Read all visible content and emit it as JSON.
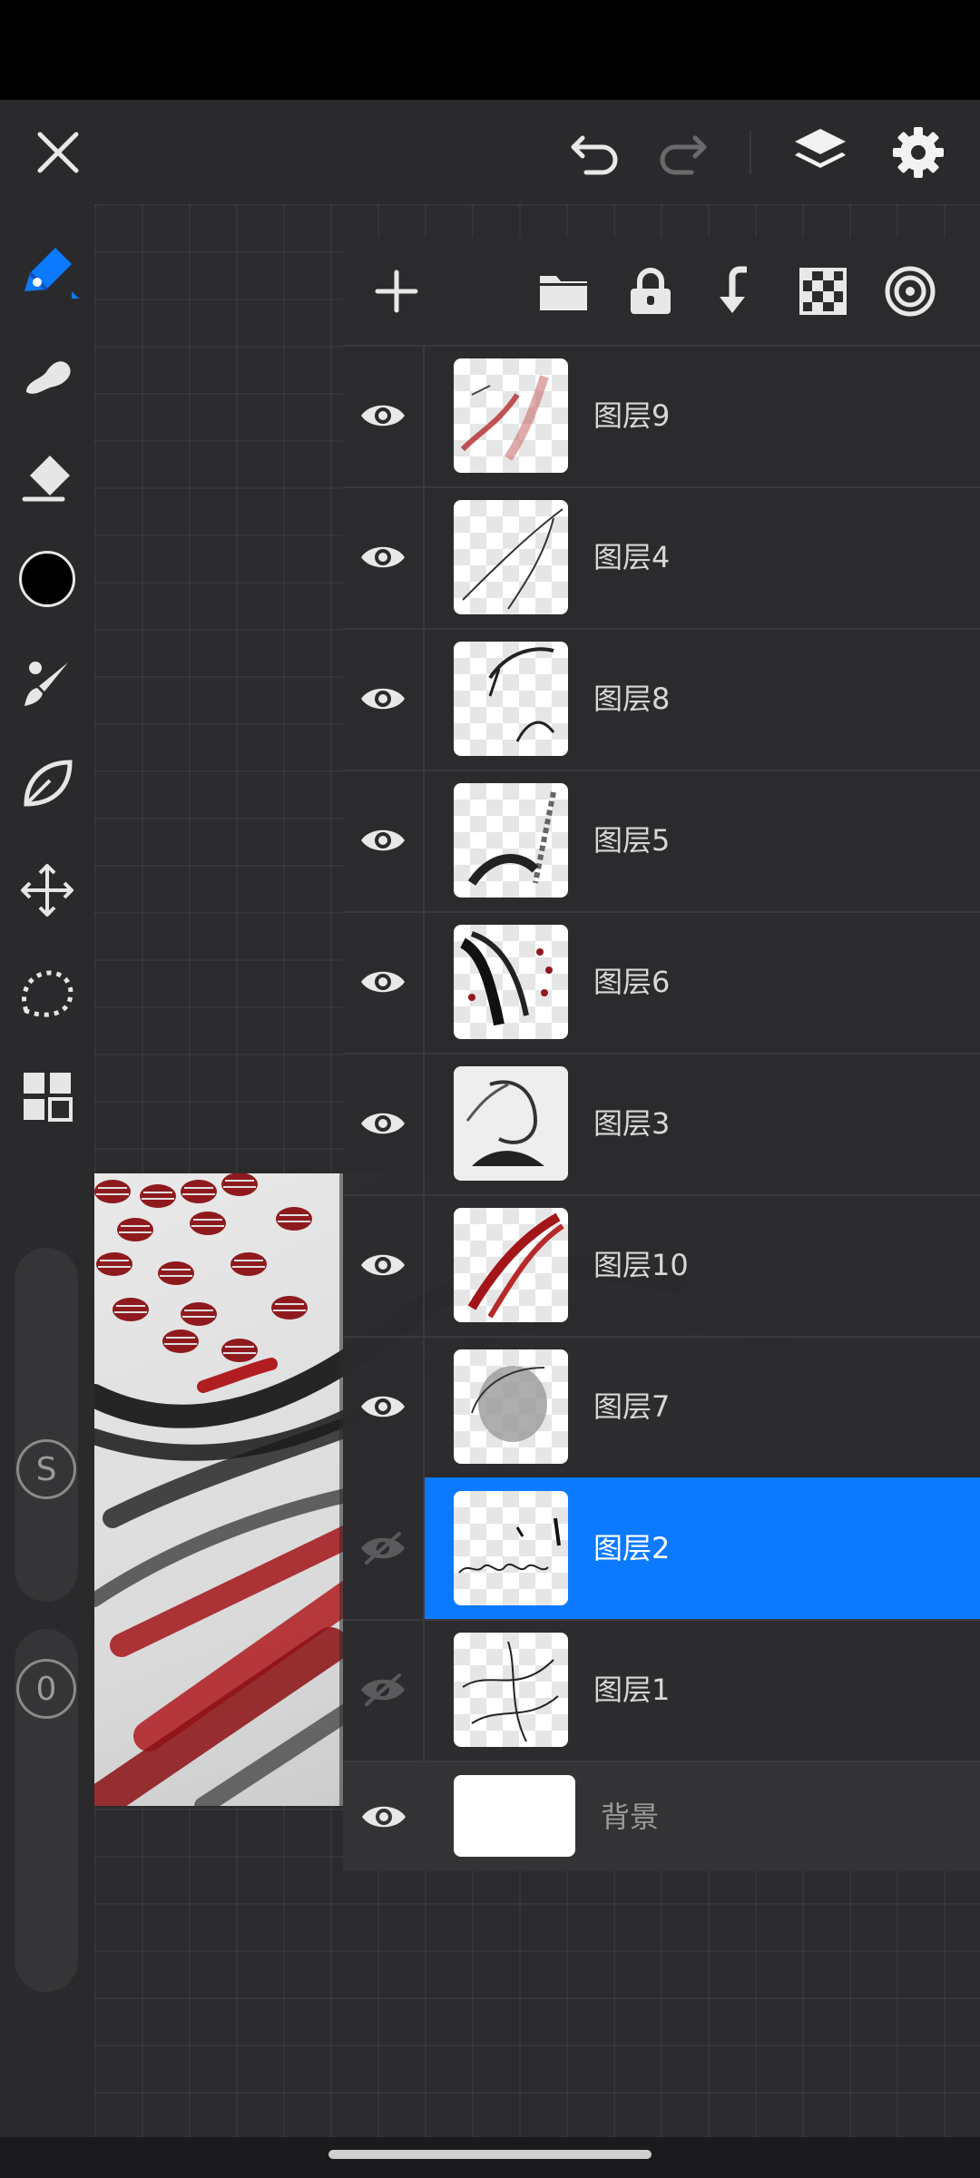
{
  "top_bar": {
    "icons": [
      "close-icon",
      "undo-icon",
      "redo-icon",
      "layers-icon",
      "settings-icon"
    ]
  },
  "sidebar": {
    "tools": [
      "pen-tool-icon",
      "smudge-icon",
      "eraser-icon",
      "color-swatch",
      "brush-icon",
      "liquify-icon",
      "transform-icon",
      "lasso-icon",
      "grid-menu-icon"
    ],
    "size_slider_label": "S",
    "opacity_slider_label": "0",
    "current_color": "#000000"
  },
  "layers_panel": {
    "toolbar_icons": [
      "add-layer-icon",
      "folder-icon",
      "lock-icon",
      "merge-down-icon",
      "transparency-lock-icon",
      "target-icon"
    ],
    "layers": [
      {
        "name": "图层9",
        "visible": true,
        "selected": false
      },
      {
        "name": "图层4",
        "visible": true,
        "selected": false
      },
      {
        "name": "图层8",
        "visible": true,
        "selected": false
      },
      {
        "name": "图层5",
        "visible": true,
        "selected": false
      },
      {
        "name": "图层6",
        "visible": true,
        "selected": false
      },
      {
        "name": "图层3",
        "visible": true,
        "selected": false
      },
      {
        "name": "图层10",
        "visible": true,
        "selected": false
      },
      {
        "name": "图层7",
        "visible": true,
        "selected": false
      },
      {
        "name": "图层2",
        "visible": false,
        "selected": true
      },
      {
        "name": "图层1",
        "visible": false,
        "selected": false
      }
    ],
    "background_layer": {
      "name": "背景",
      "visible": true
    }
  },
  "colors": {
    "accent": "#0b7aff",
    "accent_light": "#2a8cff",
    "panel": "#2b2b2d",
    "ink_red": "#a11a1e"
  }
}
